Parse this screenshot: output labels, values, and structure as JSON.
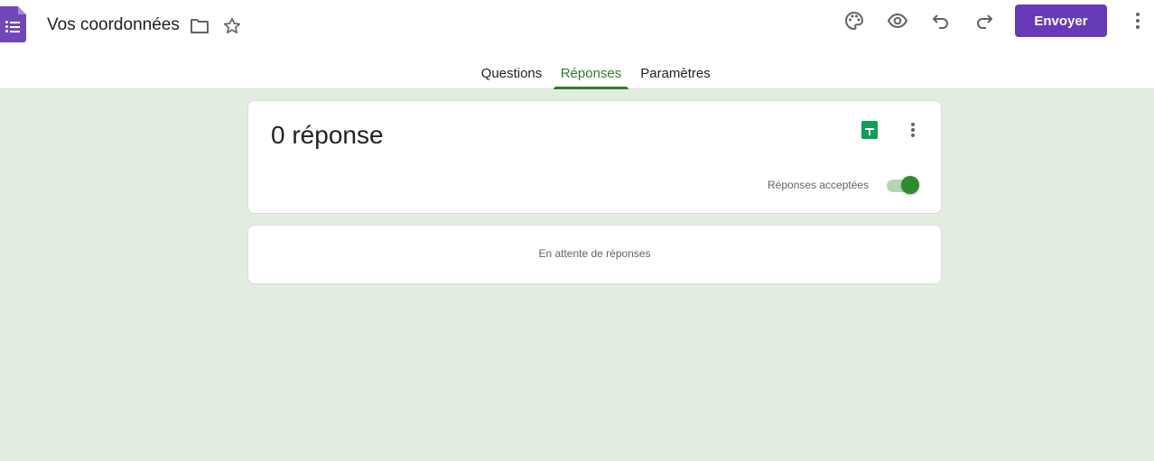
{
  "header": {
    "form_title": "Vos coordonnées",
    "send_label": "Envoyer",
    "icons": [
      "forms-logo-icon",
      "folder-icon",
      "star-icon",
      "palette-icon",
      "eye-icon",
      "undo-icon",
      "redo-icon",
      "more-vert-icon"
    ]
  },
  "tabs": [
    {
      "label": "Questions",
      "active": false
    },
    {
      "label": "Réponses",
      "active": true
    },
    {
      "label": "Paramètres",
      "active": false
    }
  ],
  "summary": {
    "count_text": "0 réponse",
    "accepting_label": "Réponses acceptées",
    "accepting_on": true
  },
  "empty_state": {
    "text": "En attente de réponses"
  },
  "colors": {
    "brand": "#673ab7",
    "accent": "#2e7d32",
    "background": "#e2ede0",
    "sheets": "#0f9d58"
  }
}
